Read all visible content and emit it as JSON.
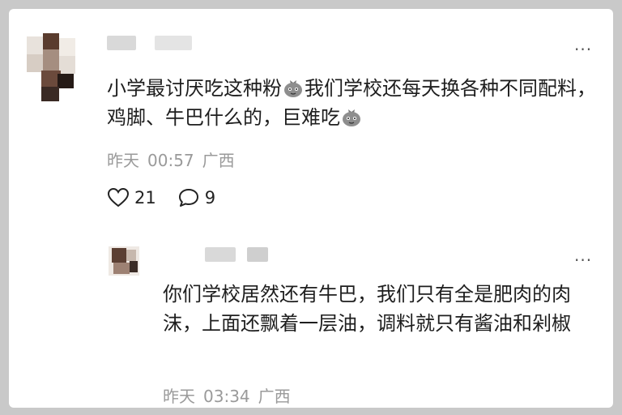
{
  "comment": {
    "text_part1": "小学最讨厌吃这种粉",
    "text_part2": "我们学校还每天换各种不同配料，鸡脚、牛巴什么的，巨难吃",
    "date": "昨天",
    "time": "00:57",
    "location": "广西",
    "likes": "21",
    "replies": "9",
    "more": "···"
  },
  "reply": {
    "text": "你们学校居然还有牛巴，我们只有全是肥肉的肉沫，上面还飘着一层油，调料就只有酱油和剁椒",
    "date": "昨天",
    "time": "03:34",
    "location": "广西",
    "more": "···"
  }
}
